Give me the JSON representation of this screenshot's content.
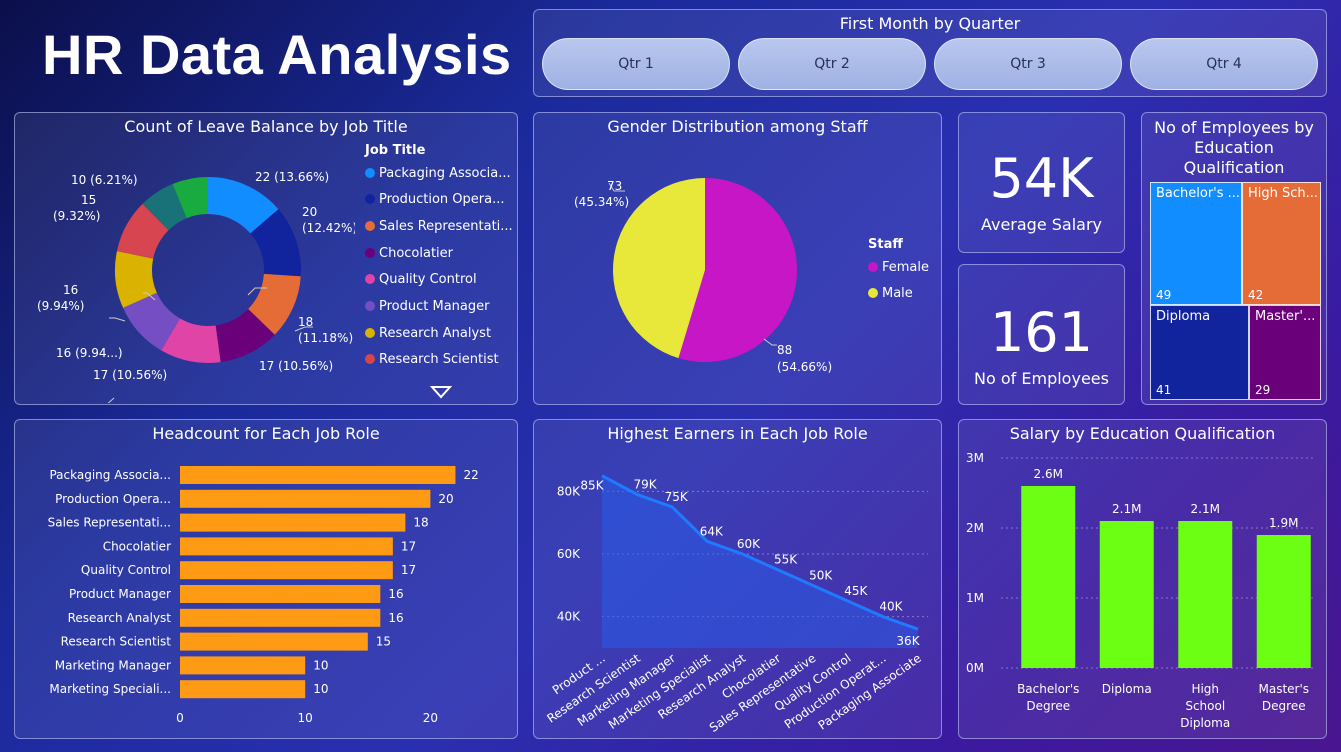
{
  "header": {
    "title": "HR Data Analysis"
  },
  "slicer": {
    "title": "First Month by Quarter",
    "buttons": [
      "Qtr 1",
      "Qtr 2",
      "Qtr 3",
      "Qtr 4"
    ]
  },
  "donut": {
    "title": "Count of Leave Balance by Job Title",
    "legend_title": "Job Title",
    "legend": [
      "Packaging Associa...",
      "Production Opera...",
      "Sales Representati...",
      "Chocolatier",
      "Quality Control",
      "Product Manager",
      "Research Analyst",
      "Research Scientist"
    ],
    "labels": [
      "22 (13.66%)",
      "20",
      "(12.42%)",
      "18",
      "(11.18%)",
      "17 (10.56%)",
      "17 (10.56%)",
      "16 (9.94...)",
      "16",
      "(9.94%)",
      "15",
      "(9.32%)",
      "10 (6.21%)"
    ]
  },
  "gender": {
    "title": "Gender Distribution among Staff",
    "legend_title": "Staff",
    "legend": [
      "Female",
      "Male"
    ],
    "labels": [
      "73",
      "(45.34%)",
      "88",
      "(54.66%)"
    ]
  },
  "kpi": {
    "salary_value": "54K",
    "salary_label": "Average Salary",
    "employees_value": "161",
    "employees_label": "No of Employees"
  },
  "treemap": {
    "title_line1": "No of Employees by",
    "title_line2": "Education",
    "title_line3": "Qualification",
    "cells": [
      {
        "label": "Bachelor's ...",
        "count": "49"
      },
      {
        "label": "High Sch...",
        "count": "42"
      },
      {
        "label": "Diploma",
        "count": "41"
      },
      {
        "label": "Master'...",
        "count": "29"
      }
    ]
  },
  "headcount": {
    "title": "Headcount for Each Job Role"
  },
  "earners": {
    "title": "Highest Earners in Each Job Role"
  },
  "salary_edu": {
    "title": "Salary by Education Qualification"
  },
  "colors": {
    "donut": [
      "#118DFF",
      "#12239E",
      "#E66C37",
      "#6B007B",
      "#E044A7",
      "#744EC2",
      "#D9B300",
      "#D64550",
      "#197278",
      "#1AAB40"
    ],
    "female": "#C616C6",
    "male": "#E8E83A",
    "bar": "#FF9A14",
    "area": "#2A5BE8",
    "green": "#6CFF14",
    "treemap": [
      "#118DFF",
      "#E66C37",
      "#12239E",
      "#6B007B"
    ]
  },
  "chart_data": [
    {
      "type": "pie",
      "title": "Count of Leave Balance by Job Title",
      "categories": [
        "Packaging Associa...",
        "Production Opera...",
        "Sales Representati...",
        "Chocolatier",
        "Quality Control",
        "Product Manager",
        "Research Analyst",
        "Research Scientist",
        "",
        ""
      ],
      "values": [
        22,
        20,
        18,
        17,
        17,
        16,
        16,
        15,
        10,
        10
      ],
      "legend": "right"
    },
    {
      "type": "pie",
      "title": "Gender Distribution among Staff",
      "categories": [
        "Female",
        "Male"
      ],
      "values": [
        88,
        73
      ],
      "legend": "right"
    },
    {
      "type": "bar",
      "title": "Headcount for Each Job Role",
      "categories": [
        "Packaging Associa...",
        "Production Opera...",
        "Sales Representati...",
        "Chocolatier",
        "Quality Control",
        "Product Manager",
        "Research Analyst",
        "Research Scientist",
        "Marketing Manager",
        "Marketing Speciali..."
      ],
      "values": [
        22,
        20,
        18,
        17,
        17,
        16,
        16,
        15,
        10,
        10
      ],
      "xticks": [
        "0",
        "10",
        "20"
      ],
      "xlim": [
        0,
        25
      ],
      "grid": false
    },
    {
      "type": "area",
      "title": "Highest Earners in Each Job Role",
      "categories": [
        "Product ...",
        "Research Scientist",
        "Marketing Manager",
        "Marketing Specialist",
        "Research Analyst",
        "Chocolatier",
        "Sales Representative",
        "Quality Control",
        "Production Operat...",
        "Packaging Associate"
      ],
      "values": [
        85,
        79,
        75,
        64,
        60,
        55,
        50,
        45,
        40,
        36
      ],
      "data_labels": [
        "85K",
        "79K",
        "75K",
        "64K",
        "60K",
        "55K",
        "50K",
        "45K",
        "40K",
        "36K"
      ],
      "yticks": [
        "40K",
        "60K",
        "80K"
      ],
      "ylim": [
        30,
        90
      ],
      "grid": true
    },
    {
      "type": "bar",
      "title": "Salary by Education Qualification",
      "categories": [
        "Bachelor's|Degree",
        "Diploma",
        "High|School|Diploma",
        "Master's|Degree"
      ],
      "values": [
        2.6,
        2.1,
        2.1,
        1.9
      ],
      "data_labels": [
        "2.6M",
        "2.1M",
        "2.1M",
        "1.9M"
      ],
      "yticks": [
        "0M",
        "1M",
        "2M",
        "3M"
      ],
      "ylim": [
        0,
        3
      ],
      "grid": true
    }
  ]
}
